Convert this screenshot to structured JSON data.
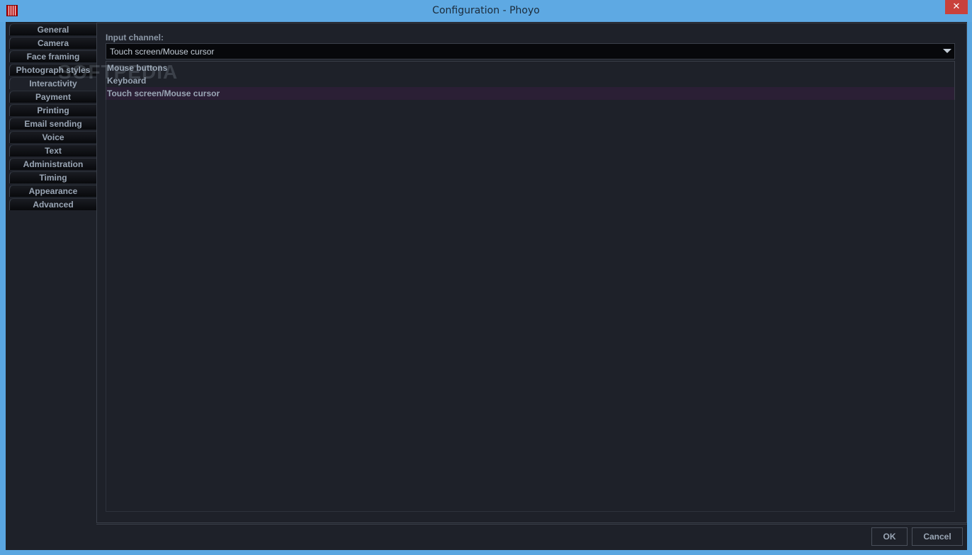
{
  "window": {
    "title": "Configuration - Phoyo",
    "close_glyph": "✕"
  },
  "tabs": [
    {
      "label": "General"
    },
    {
      "label": "Camera"
    },
    {
      "label": "Face framing"
    },
    {
      "label": "Photograph styles"
    },
    {
      "label": "Interactivity",
      "active": true
    },
    {
      "label": "Payment"
    },
    {
      "label": "Printing"
    },
    {
      "label": "Email sending"
    },
    {
      "label": "Voice"
    },
    {
      "label": "Text"
    },
    {
      "label": "Administration"
    },
    {
      "label": "Timing"
    },
    {
      "label": "Appearance"
    },
    {
      "label": "Advanced"
    }
  ],
  "input_channel": {
    "label": "Input channel:",
    "value": "Touch screen/Mouse cursor",
    "options": [
      "Mouse buttons",
      "Keyboard",
      "Touch screen/Mouse cursor"
    ],
    "selected_index": 2
  },
  "watermark": "SOFTPEDIA",
  "buttons": {
    "ok": "OK",
    "cancel": "Cancel"
  },
  "colors": {
    "background": "#1e2129",
    "titlebar": "#5ea9e3",
    "close": "#c9413b",
    "selected_option": "#2b1f35"
  }
}
